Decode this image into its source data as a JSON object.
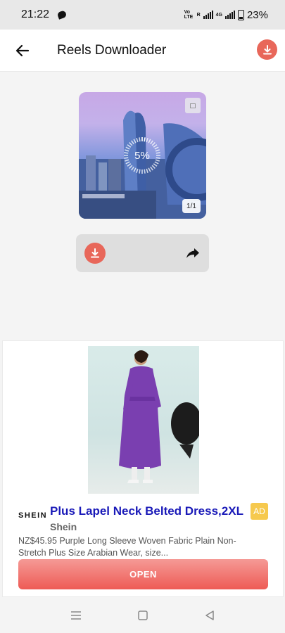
{
  "status_bar": {
    "time": "21:22",
    "network_label": "Vo LTE",
    "network_type": "4G",
    "battery_percent": "23%"
  },
  "app_bar": {
    "title": "Reels Downloader"
  },
  "preview": {
    "progress_text": "5%",
    "progress_value": 0.05,
    "page_indicator": "1/1"
  },
  "ad": {
    "brand_logo": "SHEIN",
    "title": "Plus Lapel Neck Belted Dress,2XL",
    "badge": "AD",
    "brand": "Shein",
    "description": "NZ$45.95 Purple Long Sleeve Woven Fabric Plain Non-Stretch Plus Size Arabian Wear, size...",
    "cta": "OPEN"
  },
  "colors": {
    "accent": "#e8675a",
    "ad_title": "#1a1ab8",
    "ad_badge": "#f6c94e"
  },
  "icons": {
    "back": "arrow-left-icon",
    "download": "download-icon",
    "share": "share-arrow-icon",
    "nav_menu": "menu-lines-icon",
    "nav_home": "square-icon",
    "nav_back": "triangle-back-icon"
  }
}
